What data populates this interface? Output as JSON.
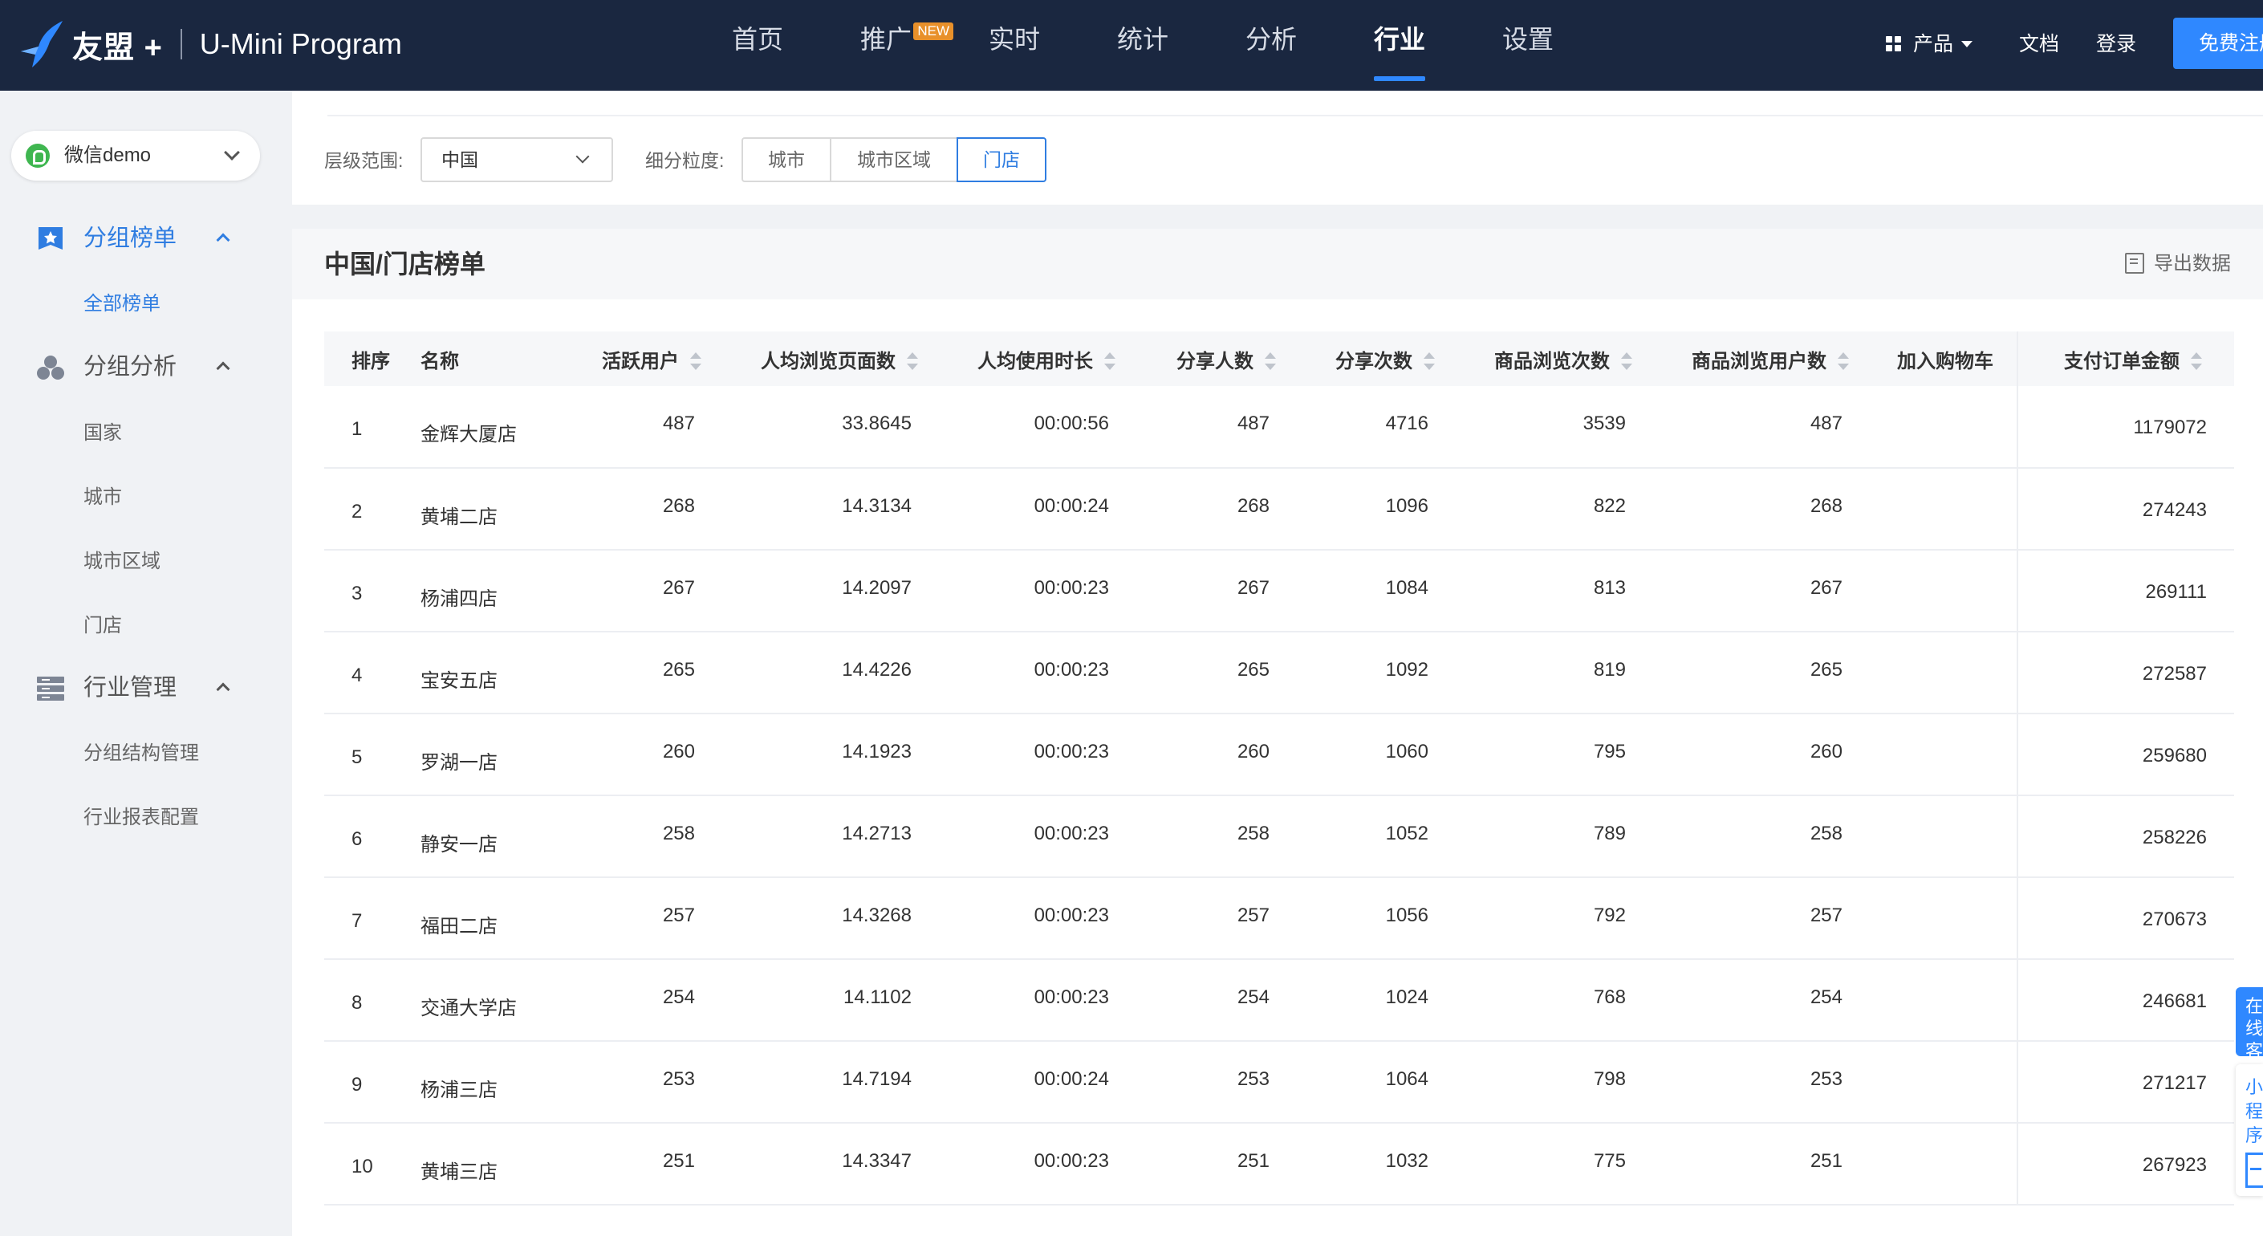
{
  "header": {
    "brand": "友盟",
    "brand_plus": "+",
    "product": "U-Mini Program",
    "nav": [
      {
        "label": "首页"
      },
      {
        "label": "推广",
        "badge": "NEW"
      },
      {
        "label": "实时"
      },
      {
        "label": "统计"
      },
      {
        "label": "分析"
      },
      {
        "label": "行业",
        "active": true
      },
      {
        "label": "设置"
      }
    ],
    "products_label": "产品",
    "docs_label": "文档",
    "login_label": "登录",
    "register_label": "免费注册"
  },
  "sidebar": {
    "app_name": "微信demo",
    "groups": [
      {
        "label": "分组榜单",
        "icon": "star-badge-icon",
        "items": [
          {
            "label": "全部榜单",
            "active": true
          }
        ]
      },
      {
        "label": "分组分析",
        "icon": "cluster-icon",
        "items": [
          {
            "label": "国家"
          },
          {
            "label": "城市"
          },
          {
            "label": "城市区域"
          },
          {
            "label": "门店"
          }
        ]
      },
      {
        "label": "行业管理",
        "icon": "server-icon",
        "items": [
          {
            "label": "分组结构管理"
          },
          {
            "label": "行业报表配置"
          }
        ]
      }
    ]
  },
  "filters": {
    "scope_label": "层级范围:",
    "scope_value": "中国",
    "granularity_label": "细分粒度:",
    "granularity_options": [
      "城市",
      "城市区域",
      "门店"
    ],
    "granularity_selected": "门店"
  },
  "ranking": {
    "title": "中国/门店榜单",
    "export_label": "导出数据",
    "columns": [
      "排序",
      "名称",
      "活跃用户",
      "人均浏览页面数",
      "人均使用时长",
      "分享人数",
      "分享次数",
      "商品浏览次数",
      "商品浏览用户数",
      "加入购物车",
      "支付订单金额"
    ],
    "rows": [
      {
        "rank": "1",
        "name": "金辉大厦店",
        "active": "487",
        "pages": "33.8645",
        "duration": "00:00:56",
        "sharers": "487",
        "shares": "4716",
        "views": "3539",
        "viewers": "487",
        "cart": "",
        "pay": "1179072"
      },
      {
        "rank": "2",
        "name": "黄埔二店",
        "active": "268",
        "pages": "14.3134",
        "duration": "00:00:24",
        "sharers": "268",
        "shares": "1096",
        "views": "822",
        "viewers": "268",
        "cart": "",
        "pay": "274243"
      },
      {
        "rank": "3",
        "name": "杨浦四店",
        "active": "267",
        "pages": "14.2097",
        "duration": "00:00:23",
        "sharers": "267",
        "shares": "1084",
        "views": "813",
        "viewers": "267",
        "cart": "",
        "pay": "269111"
      },
      {
        "rank": "4",
        "name": "宝安五店",
        "active": "265",
        "pages": "14.4226",
        "duration": "00:00:23",
        "sharers": "265",
        "shares": "1092",
        "views": "819",
        "viewers": "265",
        "cart": "",
        "pay": "272587"
      },
      {
        "rank": "5",
        "name": "罗湖一店",
        "active": "260",
        "pages": "14.1923",
        "duration": "00:00:23",
        "sharers": "260",
        "shares": "1060",
        "views": "795",
        "viewers": "260",
        "cart": "",
        "pay": "259680"
      },
      {
        "rank": "6",
        "name": "静安一店",
        "active": "258",
        "pages": "14.2713",
        "duration": "00:00:23",
        "sharers": "258",
        "shares": "1052",
        "views": "789",
        "viewers": "258",
        "cart": "",
        "pay": "258226"
      },
      {
        "rank": "7",
        "name": "福田二店",
        "active": "257",
        "pages": "14.3268",
        "duration": "00:00:23",
        "sharers": "257",
        "shares": "1056",
        "views": "792",
        "viewers": "257",
        "cart": "",
        "pay": "270673"
      },
      {
        "rank": "8",
        "name": "交通大学店",
        "active": "254",
        "pages": "14.1102",
        "duration": "00:00:23",
        "sharers": "254",
        "shares": "1024",
        "views": "768",
        "viewers": "254",
        "cart": "",
        "pay": "246681"
      },
      {
        "rank": "9",
        "name": "杨浦三店",
        "active": "253",
        "pages": "14.7194",
        "duration": "00:00:24",
        "sharers": "253",
        "shares": "1064",
        "views": "798",
        "viewers": "253",
        "cart": "",
        "pay": "271217"
      },
      {
        "rank": "10",
        "name": "黄埔三店",
        "active": "251",
        "pages": "14.3347",
        "duration": "00:00:23",
        "sharers": "251",
        "shares": "1032",
        "views": "775",
        "viewers": "251",
        "cart": "",
        "pay": "267923"
      }
    ]
  },
  "float_service": {
    "online_label": "在线客服",
    "mini_label": "小程序"
  },
  "colors": {
    "header_bg": "#1a2740",
    "accent": "#2f88ff",
    "active_link": "#2f7de1",
    "badge": "#e8902a"
  }
}
